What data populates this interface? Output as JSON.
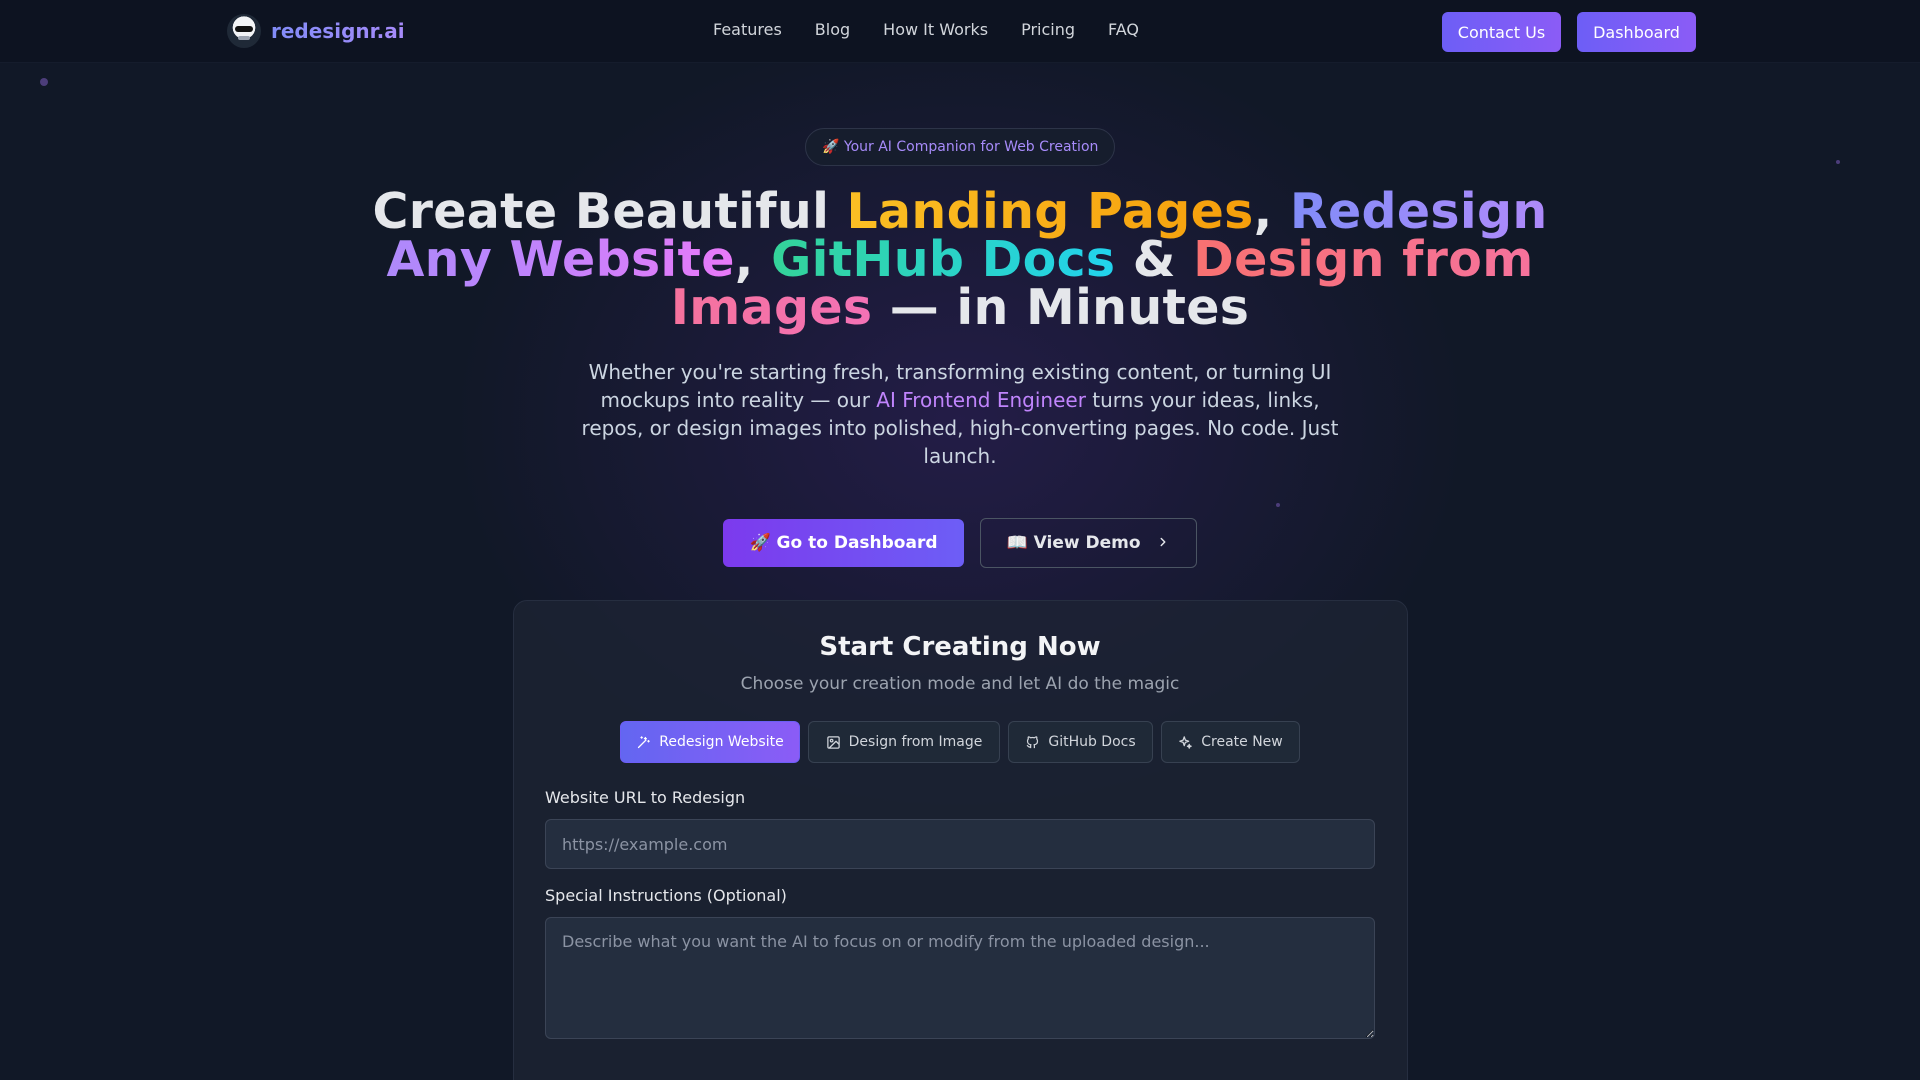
{
  "header": {
    "brand": "redesignr.ai",
    "nav": [
      "Features",
      "Blog",
      "How It Works",
      "Pricing",
      "FAQ"
    ],
    "contact_label": "Contact Us",
    "dashboard_label": "Dashboard"
  },
  "hero": {
    "badge": "🚀 Your AI Companion for Web Creation",
    "title": {
      "t1": "Create Beautiful ",
      "t2": "Landing Pages",
      "t3": ", ",
      "t4": "Redesign Any Website",
      "t5": ", ",
      "t6": "GitHub Docs",
      "t7": " & ",
      "t8": "Design from Images",
      "t9": " — in Minutes"
    },
    "subtitle_before": "Whether you're starting fresh, transforming existing content, or turning UI mockups into reality — our ",
    "subtitle_highlight": "AI Frontend Engineer",
    "subtitle_after": " turns your ideas, links, repos, or design images into polished, high-converting pages. No code. Just launch.",
    "primary_cta": "🚀 Go to Dashboard",
    "secondary_cta": "📖 View Demo"
  },
  "creator": {
    "title": "Start Creating Now",
    "subtitle": "Choose your creation mode and let AI do the magic",
    "tabs": [
      {
        "label": "Redesign Website",
        "icon": "magic-wand-icon",
        "active": true
      },
      {
        "label": "Design from Image",
        "icon": "image-icon",
        "active": false
      },
      {
        "label": "GitHub Docs",
        "icon": "github-icon",
        "active": false
      },
      {
        "label": "Create New",
        "icon": "sparkles-icon",
        "active": false
      }
    ],
    "url_label": "Website URL to Redesign",
    "url_placeholder": "https://example.com",
    "instructions_label": "Special Instructions (Optional)",
    "instructions_placeholder": "Describe what you want the AI to focus on or modify from the uploaded design..."
  },
  "colors": {
    "background": "#111827",
    "accent": "#8b5cf6",
    "highlight": "#c084fc"
  }
}
